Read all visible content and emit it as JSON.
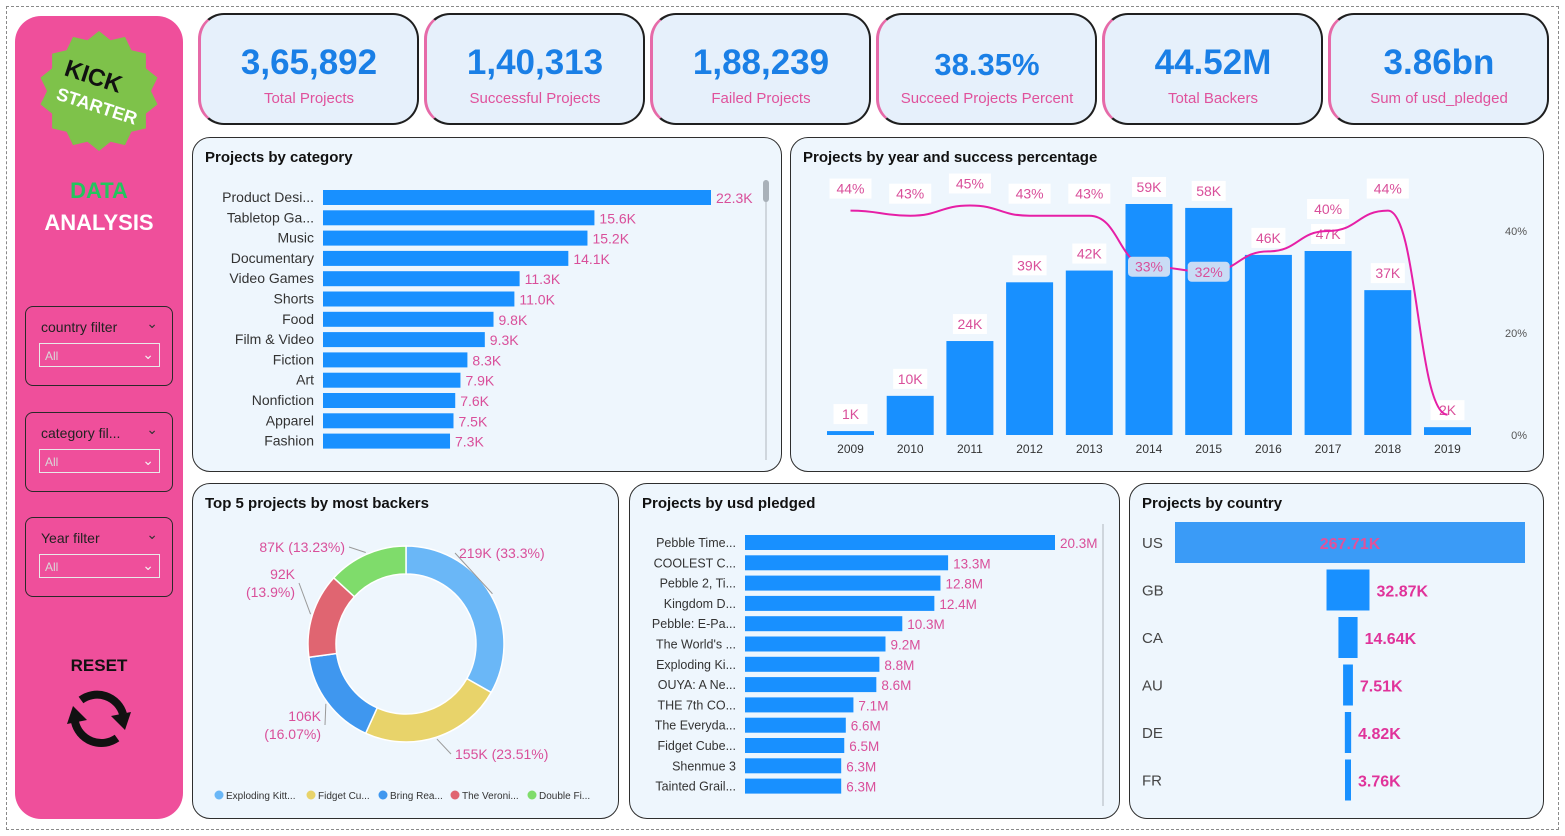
{
  "sidebar": {
    "logo_line1": "KICK",
    "logo_line2": "STARTER",
    "title_line1": "DATA",
    "title_line2": "ANALYSIS",
    "filters": [
      {
        "label": "country filter",
        "value": "All"
      },
      {
        "label": "category fil...",
        "value": "All"
      },
      {
        "label": "Year filter",
        "value": "All"
      }
    ],
    "reset_label": "RESET"
  },
  "kpis": [
    {
      "value": "3,65,892",
      "label": "Total Projects"
    },
    {
      "value": "1,40,313",
      "label": "Successful Projects"
    },
    {
      "value": "1,88,239",
      "label": "Failed Projects"
    },
    {
      "value": "38.35%",
      "label": "Succeed Projects Percent"
    },
    {
      "value": "44.52M",
      "label": "Total Backers"
    },
    {
      "value": "3.86bn",
      "label": "Sum of usd_pledged"
    }
  ],
  "panels": {
    "category": "Projects by category",
    "year": "Projects by year and success percentage",
    "backers": "Top 5 projects by most backers",
    "pledged": "Projects by usd pledged",
    "country": "Projects by country"
  },
  "colors": {
    "pink": "#ef4f9b",
    "blue": "#1890ff",
    "label_pink": "#d94f9a",
    "line_magenta": "#e61fa6",
    "kpi_value": "#1a7fe6"
  },
  "chart_data": [
    {
      "type": "bar",
      "orientation": "horizontal",
      "title": "Projects by category",
      "categories": [
        "Product Desi...",
        "Tabletop Ga...",
        "Music",
        "Documentary",
        "Video Games",
        "Shorts",
        "Food",
        "Film & Video",
        "Fiction",
        "Art",
        "Nonfiction",
        "Apparel",
        "Fashion"
      ],
      "values": [
        22300,
        15600,
        15200,
        14100,
        11300,
        11000,
        9800,
        9300,
        8300,
        7900,
        7600,
        7500,
        7300
      ],
      "labels": [
        "22.3K",
        "15.6K",
        "15.2K",
        "14.1K",
        "11.3K",
        "11.0K",
        "9.8K",
        "9.3K",
        "8.3K",
        "7.9K",
        "7.6K",
        "7.5K",
        "7.3K"
      ]
    },
    {
      "type": "bar",
      "title": "Projects by year and success percentage",
      "categories": [
        "2009",
        "2010",
        "2011",
        "2012",
        "2013",
        "2014",
        "2015",
        "2016",
        "2017",
        "2018",
        "2019"
      ],
      "series": [
        {
          "type": "bar",
          "values": [
            1000,
            10000,
            24000,
            39000,
            42000,
            59000,
            58000,
            46000,
            47000,
            37000,
            2000
          ],
          "labels": [
            "1K",
            "10K",
            "24K",
            "39K",
            "42K",
            "59K",
            "58K",
            "46K",
            "47K",
            "37K",
            "2K"
          ]
        },
        {
          "type": "line",
          "values": [
            44,
            43,
            45,
            43,
            43,
            33,
            32,
            36,
            40,
            44,
            4
          ],
          "labels": [
            "44%",
            "43%",
            "45%",
            "43%",
            "43%",
            "33%",
            "32%",
            "",
            "40%",
            "44%",
            ""
          ]
        }
      ],
      "y2_ticks": [
        "0%",
        "20%",
        "40%"
      ],
      "y2lim": [
        0,
        40
      ]
    },
    {
      "type": "pie",
      "title": "Top 5 projects by most backers",
      "series_labels": [
        "Exploding Kitt...",
        "Fidget Cu...",
        "Bring Rea...",
        "The Veroni...",
        "Double Fi..."
      ],
      "values": [
        219000,
        155000,
        106000,
        92000,
        87000
      ],
      "labels": [
        "219K (33.3%)",
        "155K (23.51%)",
        "106K (16.07%)",
        "92K (13.9%)",
        "87K (13.23%)"
      ],
      "colors": [
        "#6ab7f7",
        "#e8d36a",
        "#3f97ef",
        "#e06571",
        "#7fdc6b"
      ]
    },
    {
      "type": "bar",
      "orientation": "horizontal",
      "title": "Projects by usd pledged",
      "categories": [
        "Pebble Time...",
        "COOLEST C...",
        "Pebble 2, Ti...",
        "Kingdom D...",
        "Pebble: E-Pa...",
        "The World's ...",
        "Exploding Ki...",
        "OUYA: A Ne...",
        "THE 7th CO...",
        "The Everyda...",
        "Fidget Cube...",
        "Shenmue 3",
        "Tainted Grail..."
      ],
      "values": [
        20300000,
        13300000,
        12800000,
        12400000,
        10300000,
        9200000,
        8800000,
        8600000,
        7100000,
        6600000,
        6500000,
        6300000,
        6300000
      ],
      "labels": [
        "20.3M",
        "13.3M",
        "12.8M",
        "12.4M",
        "10.3M",
        "9.2M",
        "8.8M",
        "8.6M",
        "7.1M",
        "6.6M",
        "6.5M",
        "6.3M",
        "6.3M"
      ]
    },
    {
      "type": "bar",
      "orientation": "horizontal",
      "title": "Projects by country",
      "categories": [
        "US",
        "GB",
        "CA",
        "AU",
        "DE",
        "FR"
      ],
      "values": [
        267710,
        32870,
        14640,
        7510,
        4820,
        3760
      ],
      "labels": [
        "267.71K",
        "32.87K",
        "14.64K",
        "7.51K",
        "4.82K",
        "3.76K"
      ]
    }
  ]
}
